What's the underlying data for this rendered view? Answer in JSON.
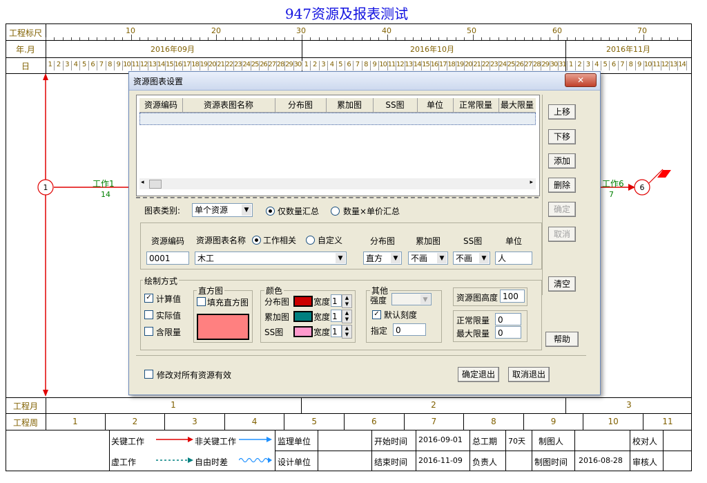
{
  "page_title": "947资源及报表测试",
  "scale_rows": {
    "ruler_label": "工程标尺",
    "month_label": "年.月",
    "day_label": "日",
    "ruler_numbers": [
      "10",
      "20",
      "30",
      "40",
      "50",
      "60",
      "70"
    ],
    "months": [
      "2016年09月",
      "2016年10月",
      "2016年11月"
    ],
    "eng_month_label": "工程月",
    "eng_months": [
      "1",
      "2",
      "3"
    ],
    "eng_week_label": "工程周",
    "eng_weeks": [
      "1",
      "2",
      "3",
      "4",
      "5",
      "6",
      "7",
      "8",
      "9",
      "10",
      "11"
    ]
  },
  "network": {
    "node1": "1",
    "node6": "6",
    "work1_name": "工作1",
    "work1_dur": "14",
    "work6_name": "工作6",
    "work6_dur": "7"
  },
  "legend": {
    "critical": "关键工作",
    "noncritical": "非关键工作",
    "virtual": "虚工作",
    "free_float": "自由时差",
    "supervisor_label": "监理单位",
    "design_label": "设计单位",
    "start_label": "开始时间",
    "start_value": "2016-09-01",
    "end_label": "结束时间",
    "end_value": "2016-11-09",
    "total_label": "总工期",
    "total_value": "70天",
    "owner_label": "负责人",
    "drawer_label": "制图人",
    "drawtime_label": "制图时间",
    "drawtime_value": "2016-08-28",
    "checker_label": "校对人",
    "reviewer_label": "审核人"
  },
  "dialog": {
    "title": "资源图表设置",
    "close_glyph": "✕",
    "table_headers": [
      "资源编码",
      "资源表图名称",
      "分布图",
      "累加图",
      "SS图",
      "单位",
      "正常限量",
      "最大限量"
    ],
    "side_buttons": {
      "up": "上移",
      "down": "下移",
      "add": "添加",
      "delete": "删除",
      "confirm": "确定",
      "cancel": "取消",
      "clear": "清空",
      "help": "帮助"
    },
    "chart_type_label": "图表类别:",
    "chart_type_value": "单个资源",
    "qty_only": "仅数量汇总",
    "qty_price": "数量×单价汇总",
    "res_code_label": "资源编码",
    "res_name_label": "资源图表名称",
    "work_related": "工作相关",
    "custom": "自定义",
    "dist_label": "分布图",
    "cum_label": "累加图",
    "ss_label": "SS图",
    "unit_label": "单位",
    "res_code_value": "0001",
    "res_name_value": "木工",
    "dist_value": "直方",
    "cum_value": "不画",
    "ss_value": "不画",
    "unit_value": "人",
    "draw_mode_label": "绘制方式",
    "calc_value": "计算值",
    "actual_value": "实际值",
    "with_limit": "含限量",
    "histogram_label": "直方图",
    "fill_hist": "填充直方图",
    "color_label": "颜色",
    "dist_color_label": "分布图",
    "cum_color_label": "累加图",
    "ss_color_label": "SS图",
    "width_label": "宽度",
    "width_values": [
      "1",
      "1",
      "1"
    ],
    "colors": {
      "dist": "#cc0000",
      "cum": "#008080",
      "ss": "#ff99cc",
      "hist": "#ff8080"
    },
    "other_label": "其他",
    "strength_label": "强度",
    "default_scale": "默认刻度",
    "specify_label": "指定",
    "specify_value": "0",
    "res_height_label": "资源图高度",
    "res_height_value": "100",
    "normal_limit_label": "正常限量",
    "normal_limit_value": "0",
    "max_limit_label": "最大限量",
    "max_limit_value": "0",
    "apply_all": "修改对所有资源有效",
    "ok_exit": "确定退出",
    "cancel_exit": "取消退出"
  }
}
